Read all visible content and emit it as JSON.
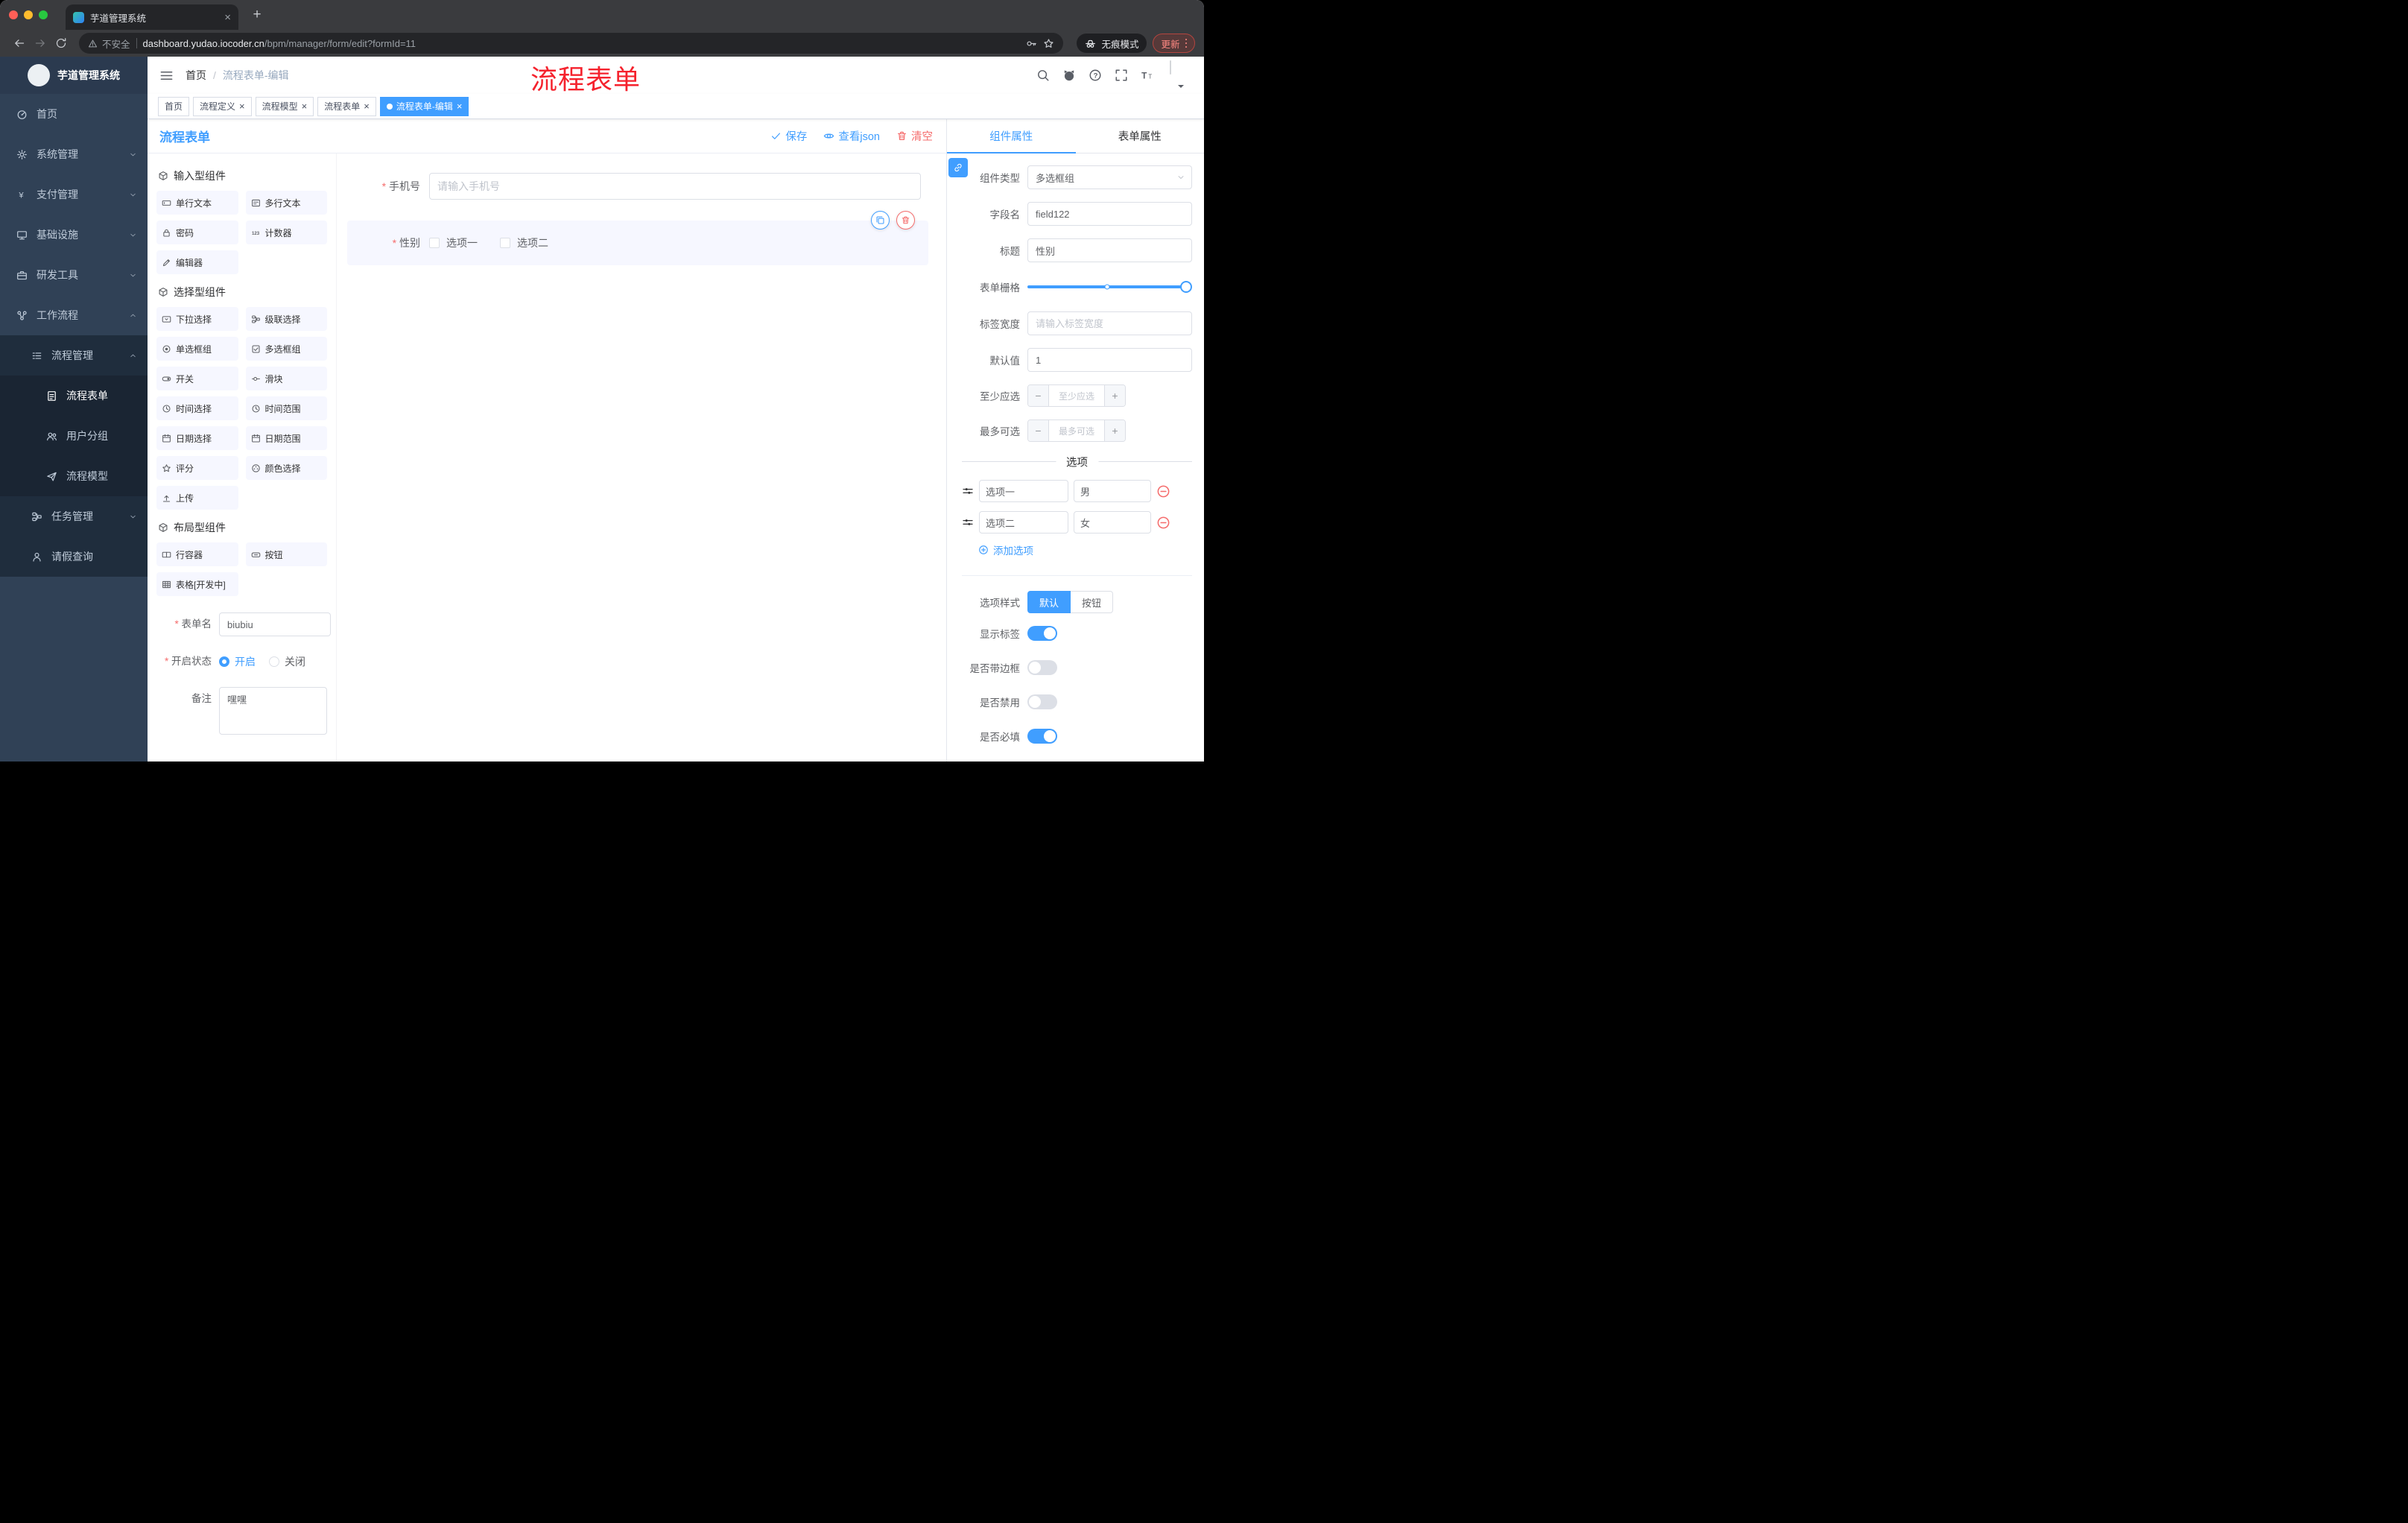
{
  "glyphs": {
    "close": "×",
    "new_tab": "+",
    "minus": "−",
    "plus": "+"
  },
  "browser": {
    "tab_title": "芋道管理系统",
    "address": {
      "security_label": "不安全",
      "host": "dashboard.yudao.iocoder.cn",
      "path": "/bpm/manager/form/edit?formId=11"
    },
    "incognito_label": "无痕模式",
    "update_label": "更新"
  },
  "annotation": {
    "text": "流程表单"
  },
  "sidebar": {
    "logo_title": "芋道管理系统",
    "items": [
      {
        "label": "首页",
        "icon": "dashboard-icon"
      },
      {
        "label": "系统管理",
        "icon": "gear-icon"
      },
      {
        "label": "支付管理",
        "icon": "payment-icon"
      },
      {
        "label": "基础设施",
        "icon": "infrastructure-icon"
      },
      {
        "label": "研发工具",
        "icon": "devtools-icon"
      },
      {
        "label": "工作流程",
        "icon": "workflow-icon",
        "expanded": true
      }
    ],
    "submenu": [
      {
        "label": "流程管理",
        "icon": "process-management-icon",
        "expanded": true
      },
      {
        "label": "流程表单",
        "icon": "process-form-icon",
        "active": true
      },
      {
        "label": "用户分组",
        "icon": "user-group-icon"
      },
      {
        "label": "流程模型",
        "icon": "process-model-icon"
      },
      {
        "label": "任务管理",
        "icon": "task-management-icon"
      },
      {
        "label": "请假查询",
        "icon": "leave-query-icon"
      }
    ]
  },
  "navbar": {
    "breadcrumb_home": "首页",
    "breadcrumb_separator": "/",
    "breadcrumb_current": "流程表单-编辑"
  },
  "tags": [
    {
      "label": "首页",
      "closable": false,
      "active": false
    },
    {
      "label": "流程定义",
      "closable": true,
      "active": false
    },
    {
      "label": "流程模型",
      "closable": true,
      "active": false
    },
    {
      "label": "流程表单",
      "closable": true,
      "active": false
    },
    {
      "label": "流程表单-编辑",
      "closable": true,
      "active": true
    }
  ],
  "designer": {
    "title": "流程表单",
    "actions": {
      "save": "保存",
      "view_json": "查看json",
      "clear": "清空"
    },
    "groups": [
      {
        "title": "输入型组件",
        "items": [
          {
            "label": "单行文本",
            "icon": "single-line-text-icon"
          },
          {
            "label": "多行文本",
            "icon": "multi-line-text-icon"
          },
          {
            "label": "密码",
            "icon": "password-icon"
          },
          {
            "label": "计数器",
            "icon": "counter-icon"
          },
          {
            "label": "编辑器",
            "icon": "editor-icon"
          }
        ]
      },
      {
        "title": "选择型组件",
        "items": [
          {
            "label": "下拉选择",
            "icon": "select-icon"
          },
          {
            "label": "级联选择",
            "icon": "cascader-icon"
          },
          {
            "label": "单选框组",
            "icon": "radio-group-icon"
          },
          {
            "label": "多选框组",
            "icon": "checkbox-group-icon"
          },
          {
            "label": "开关",
            "icon": "switch-icon"
          },
          {
            "label": "滑块",
            "icon": "slider-icon"
          },
          {
            "label": "时间选择",
            "icon": "time-picker-icon"
          },
          {
            "label": "时间范围",
            "icon": "time-range-icon"
          },
          {
            "label": "日期选择",
            "icon": "date-picker-icon"
          },
          {
            "label": "日期范围",
            "icon": "date-range-icon"
          },
          {
            "label": "评分",
            "icon": "rate-icon"
          },
          {
            "label": "颜色选择",
            "icon": "color-picker-icon"
          },
          {
            "label": "上传",
            "icon": "upload-icon"
          }
        ]
      },
      {
        "title": "布局型组件",
        "items": [
          {
            "label": "行容器",
            "icon": "row-container-icon"
          },
          {
            "label": "按钮",
            "icon": "button-icon"
          },
          {
            "label": "表格[开发中]",
            "icon": "table-icon"
          }
        ]
      }
    ],
    "meta": {
      "name_label": "表单名",
      "name_value": "biubiu",
      "name_required": true,
      "status_label": "开启状态",
      "status_required": true,
      "status_on": "开启",
      "status_off": "关闭",
      "status_value": "开启",
      "remark_label": "备注",
      "remark_value": "嘿嘿"
    },
    "canvas": {
      "phone": {
        "label": "手机号",
        "required": true,
        "placeholder": "请输入手机号"
      },
      "gender": {
        "label": "性别",
        "required": true,
        "option1": "选项一",
        "option2": "选项二",
        "selected": true
      }
    }
  },
  "props": {
    "tab_component": "组件属性",
    "tab_form": "表单属性",
    "component_type": {
      "label": "组件类型",
      "value": "多选框组"
    },
    "field_name": {
      "label": "字段名",
      "value": "field122"
    },
    "title": {
      "label": "标题",
      "value": "性别"
    },
    "grid": {
      "label": "表单栅格",
      "value": 24,
      "stop": 12,
      "max": 24
    },
    "label_width": {
      "label": "标签宽度",
      "placeholder": "请输入标签宽度"
    },
    "default_value": {
      "label": "默认值",
      "value": "1"
    },
    "min_select": {
      "label": "至少应选",
      "placeholder": "至少应选"
    },
    "max_select": {
      "label": "最多可选",
      "placeholder": "最多可选"
    },
    "options_divider": "选项",
    "options": [
      {
        "label": "选项一",
        "value": "男"
      },
      {
        "label": "选项二",
        "value": "女"
      }
    ],
    "add_option_label": "添加选项",
    "option_style": {
      "label": "选项样式",
      "options": [
        "默认",
        "按钮"
      ],
      "value": "默认"
    },
    "switches": [
      {
        "label": "显示标签",
        "value": true
      },
      {
        "label": "是否带边框",
        "value": false
      },
      {
        "label": "是否禁用",
        "value": false
      },
      {
        "label": "是否必填",
        "value": true
      }
    ]
  },
  "colors": {
    "accent": "#409EFF",
    "danger": "#F56C6C",
    "sidebar_bg": "#304156",
    "submenu_bg": "#1F2D3D",
    "active_tag_bg": "#409EFF",
    "annotation_red": "#F5222D",
    "selected_row_bg": "#F6F7FF",
    "palette_item_bg": "#F6F7FF"
  }
}
